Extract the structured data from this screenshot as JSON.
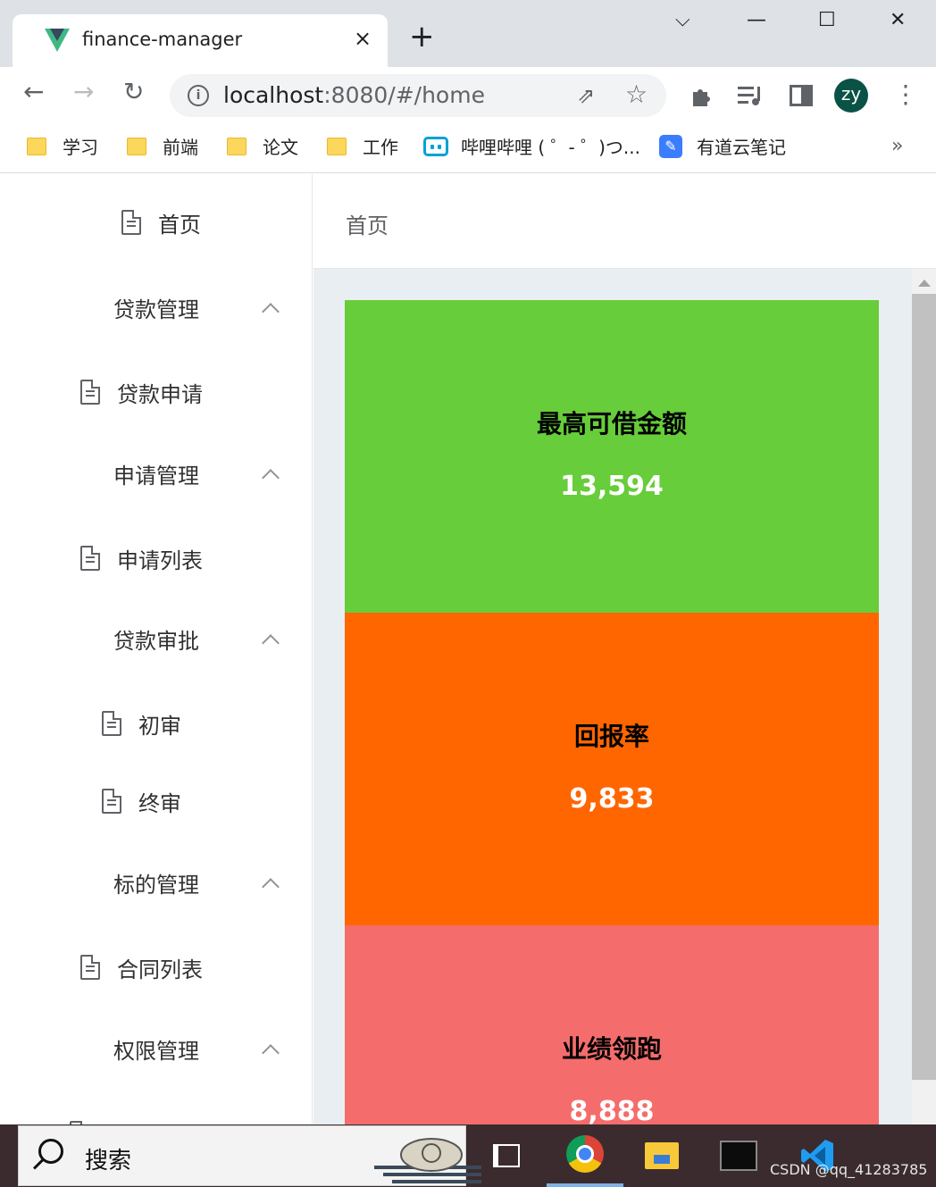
{
  "browser": {
    "tab_title": "finance-manager",
    "tab_close": "×",
    "new_tab": "+",
    "window_controls": {
      "dropdown": "⌵",
      "minimize": "—",
      "maximize": "☐",
      "close": "✕"
    },
    "url_host": "localhost",
    "url_rest": ":8080/#/home",
    "profile_initials": "zy",
    "bookmarks": [
      {
        "label": "学习",
        "icon": "folder-icon"
      },
      {
        "label": "前端",
        "icon": "folder-icon"
      },
      {
        "label": "论文",
        "icon": "folder-icon"
      },
      {
        "label": "工作",
        "icon": "folder-icon"
      },
      {
        "label": "哔哩哔哩 ( ゜- ゜)つ...",
        "icon": "bilibili-icon"
      },
      {
        "label": "有道云笔记",
        "icon": "youdao-note-icon"
      }
    ],
    "bookmarks_more": "»"
  },
  "sidebar": {
    "items": [
      {
        "label": "首页",
        "type": "item"
      },
      {
        "label": "贷款管理",
        "type": "submenu"
      },
      {
        "label": "贷款申请",
        "type": "item"
      },
      {
        "label": "申请管理",
        "type": "submenu"
      },
      {
        "label": "申请列表",
        "type": "item"
      },
      {
        "label": "贷款审批",
        "type": "submenu"
      },
      {
        "label": "初审",
        "type": "item"
      },
      {
        "label": "终审",
        "type": "item"
      },
      {
        "label": "标的管理",
        "type": "submenu"
      },
      {
        "label": "合同列表",
        "type": "item"
      },
      {
        "label": "权限管理",
        "type": "submenu"
      }
    ]
  },
  "header": {
    "breadcrumb": "首页"
  },
  "cards": [
    {
      "title": "最高可借金额",
      "value": "13,594",
      "color": "#67cd3a"
    },
    {
      "title": "回报率",
      "value": "9,833",
      "color": "#ff6600"
    },
    {
      "title": "业绩领跑",
      "value": "8,888",
      "color": "#f56c6c"
    }
  ],
  "taskbar": {
    "search_label": "搜索",
    "apps": [
      "task-view",
      "chrome",
      "file-explorer",
      "terminal",
      "vscode"
    ]
  },
  "watermark": "CSDN @qq_41283785"
}
